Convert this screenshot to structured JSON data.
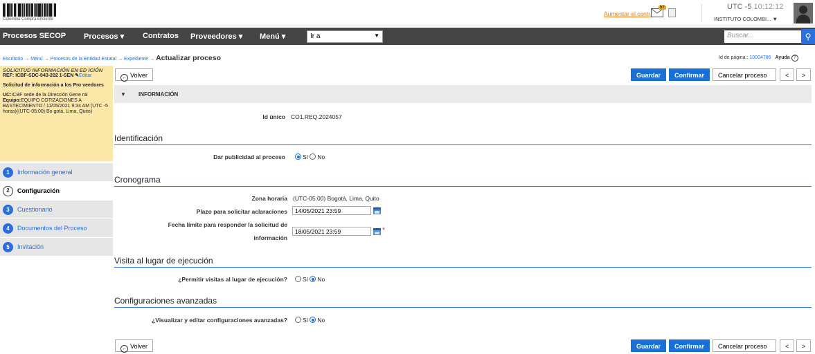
{
  "header": {
    "logo_label": "Colombia Compra Eficiente",
    "contrast_link": "Aumentar el contraste",
    "mail_badge": "57",
    "clock": "UTC -5",
    "clock_time": "10:12:12",
    "institution": "INSTITUTO COLOMBI... ▼"
  },
  "nav": {
    "items": [
      "Procesos SECOP",
      "Procesos ▾",
      "Contratos",
      "Proveedores ▾",
      "Menú ▾"
    ],
    "goto_value": "Ir a",
    "search_placeholder": "Buscar..."
  },
  "breadcrumb": {
    "items": [
      "Escritorio",
      "Menú",
      "Procesos de la Entidad Estatal",
      "Expediente"
    ],
    "separator": "→",
    "current": "Actualizar proceso"
  },
  "page_id": {
    "label": "Id de página::",
    "value": "10004786",
    "help": "Ayuda"
  },
  "sidebar": {
    "title": "SOLICITUD INFORMACIÓN EN ED ICIÓN",
    "ref": "REF: ICBF-SDC-043-202 1-SEN",
    "edit": "Editar",
    "subject": "Solicitud de información a los Pro veedores",
    "uc_label": "UC:",
    "uc_value": "ICBF sede de la Dirección Gene ral",
    "team_label": "Equipo:",
    "team_value": "EQUIPO COTIZACIONES A BASTECIMIENTO / 11/05/2021 9:34 AM (UTC -5 horas)((UTC-05:00) Bo gotá, Lima, Quito)",
    "steps": [
      {
        "num": "1",
        "label": "Información general"
      },
      {
        "num": "2",
        "label": "Configuración"
      },
      {
        "num": "3",
        "label": "Cuestionario"
      },
      {
        "num": "4",
        "label": "Documentos del Proceso"
      },
      {
        "num": "5",
        "label": "Invitación"
      }
    ]
  },
  "actions": {
    "back": "Volver",
    "save": "Guardar",
    "confirm": "Confirmar",
    "cancel": "Cancelar proceso",
    "prev": "<",
    "next": ">"
  },
  "form": {
    "info_header": "INFORMACIÓN",
    "id_label": "Id único",
    "id_value": "CO1.REQ.2024057",
    "sec_identificacion": "Identificación",
    "publicidad_label": "Dar publicidad al proceso",
    "yes": "Sí",
    "no": "No",
    "sec_cronograma": "Cronograma",
    "zona_label": "Zona horaria",
    "zona_value": "(UTC-05:00) Bogotá, Lima, Quito",
    "plazo_label": "Plazo para solicitar aclaraciones",
    "plazo_value": "14/05/2021 23:59",
    "fecha_label_1": "Fecha límite para responder la solicitud de",
    "fecha_label_2": "información",
    "fecha_value": "18/05/2021 23:59",
    "required_mark": "*",
    "sec_visita": "Visita al lugar de ejecución",
    "visita_label": "¿Permitir visitas al lugar de ejecución?",
    "sec_avanzadas": "Configuraciones avanzadas",
    "avanzadas_label": "¿Visualizar y editar configuraciones avanzadas?"
  }
}
